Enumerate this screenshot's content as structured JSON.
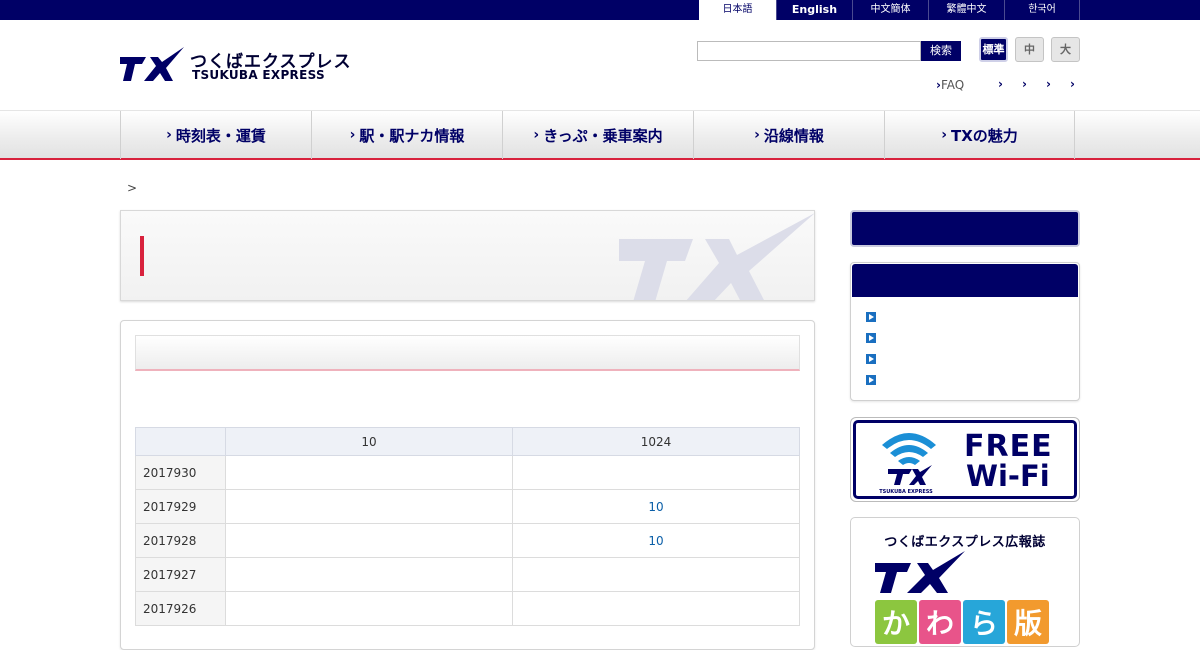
{
  "languages": [
    {
      "label": "日本語",
      "active": true
    },
    {
      "label": "English",
      "active": false
    },
    {
      "label": "中文簡体",
      "active": false
    },
    {
      "label": "繁體中文",
      "active": false
    },
    {
      "label": "한국어",
      "active": false
    }
  ],
  "logo": {
    "jp": "つくばエクスプレス",
    "en": "TSUKUBA EXPRESS",
    "mark": "TX"
  },
  "search": {
    "value": "",
    "placeholder": "",
    "button": "検索"
  },
  "font_size": {
    "standard": "標準",
    "medium": "中",
    "large": "大"
  },
  "util_links": {
    "faq": "FAQ"
  },
  "gnav": [
    {
      "label": "時刻表・運賃"
    },
    {
      "label": "駅・駅ナカ情報"
    },
    {
      "label": "きっぷ・乗車案内"
    },
    {
      "label": "沿線情報"
    },
    {
      "label": "TXの魅力"
    }
  ],
  "breadcrumb": {
    "sep": ">"
  },
  "title_box": {
    "watermark": "TX"
  },
  "table": {
    "headers": [
      "",
      "10",
      "1024"
    ],
    "rows": [
      {
        "date": "2017930",
        "c1": "",
        "c2": ""
      },
      {
        "date": "2017929",
        "c1": "",
        "c2": "10"
      },
      {
        "date": "2017928",
        "c1": "",
        "c2": "10"
      },
      {
        "date": "2017927",
        "c1": "",
        "c2": ""
      },
      {
        "date": "2017926",
        "c1": "",
        "c2": ""
      }
    ]
  },
  "banners": {
    "wifi": {
      "free": "FREE",
      "wifi": "Wi-Fi",
      "small": "TSUKUBA EXPRESS"
    },
    "kouho": {
      "title": "つくばエクスプレス広報誌",
      "kana": [
        "か",
        "わ",
        "ら",
        "版"
      ]
    }
  },
  "colors": {
    "navy": "#000066",
    "accent_red": "#d8223d",
    "link_blue": "#0b5fa8"
  }
}
